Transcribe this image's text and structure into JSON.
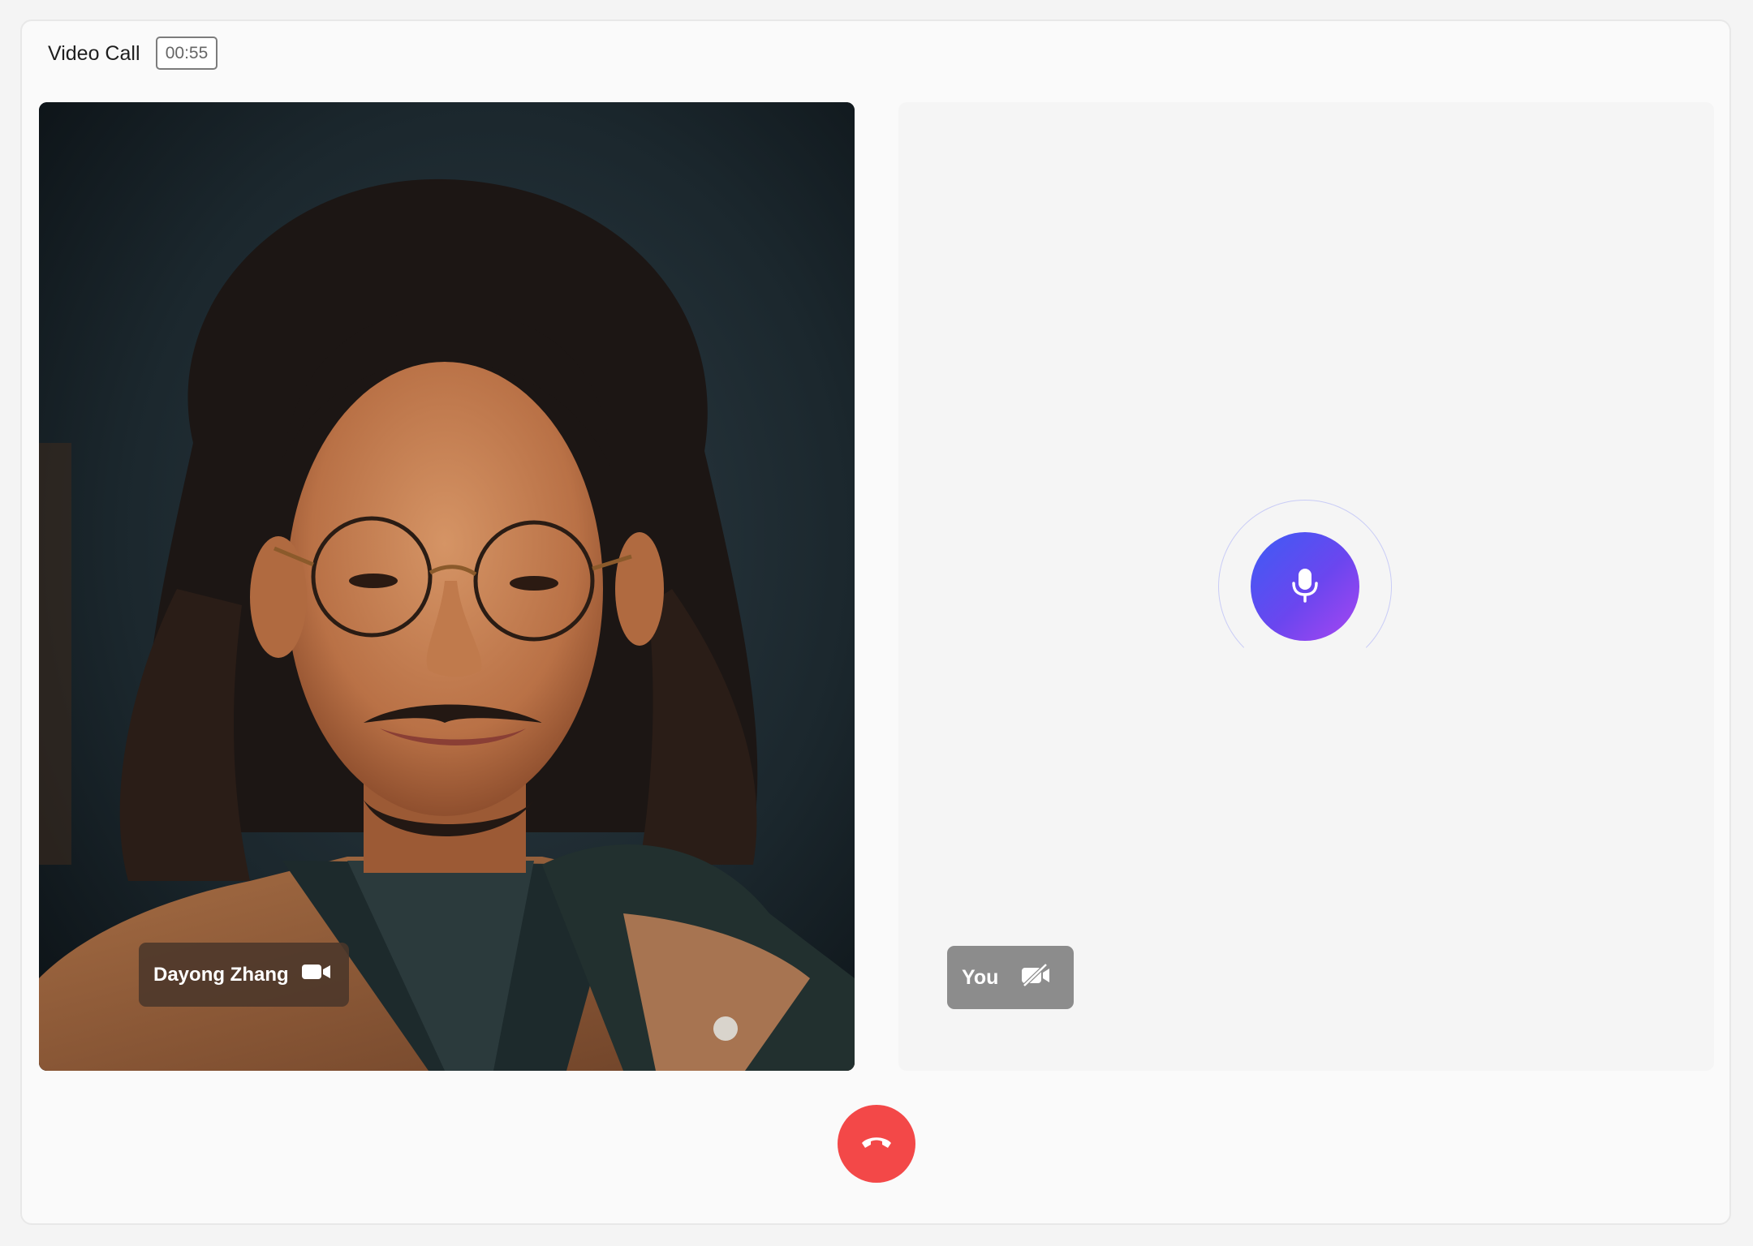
{
  "header": {
    "title": "Video Call",
    "timer": "00:55"
  },
  "remote": {
    "name": "Dayong Zhang",
    "video_icon": "video-camera-icon"
  },
  "local": {
    "label": "You",
    "video_off_icon": "video-off-icon",
    "mic_icon": "microphone-icon"
  },
  "controls": {
    "end_call_icon": "phone-hangup-icon"
  },
  "colors": {
    "accent": "#5b4ff2",
    "end_call": "#f34848",
    "tag_bg": "#8c8c8c"
  }
}
